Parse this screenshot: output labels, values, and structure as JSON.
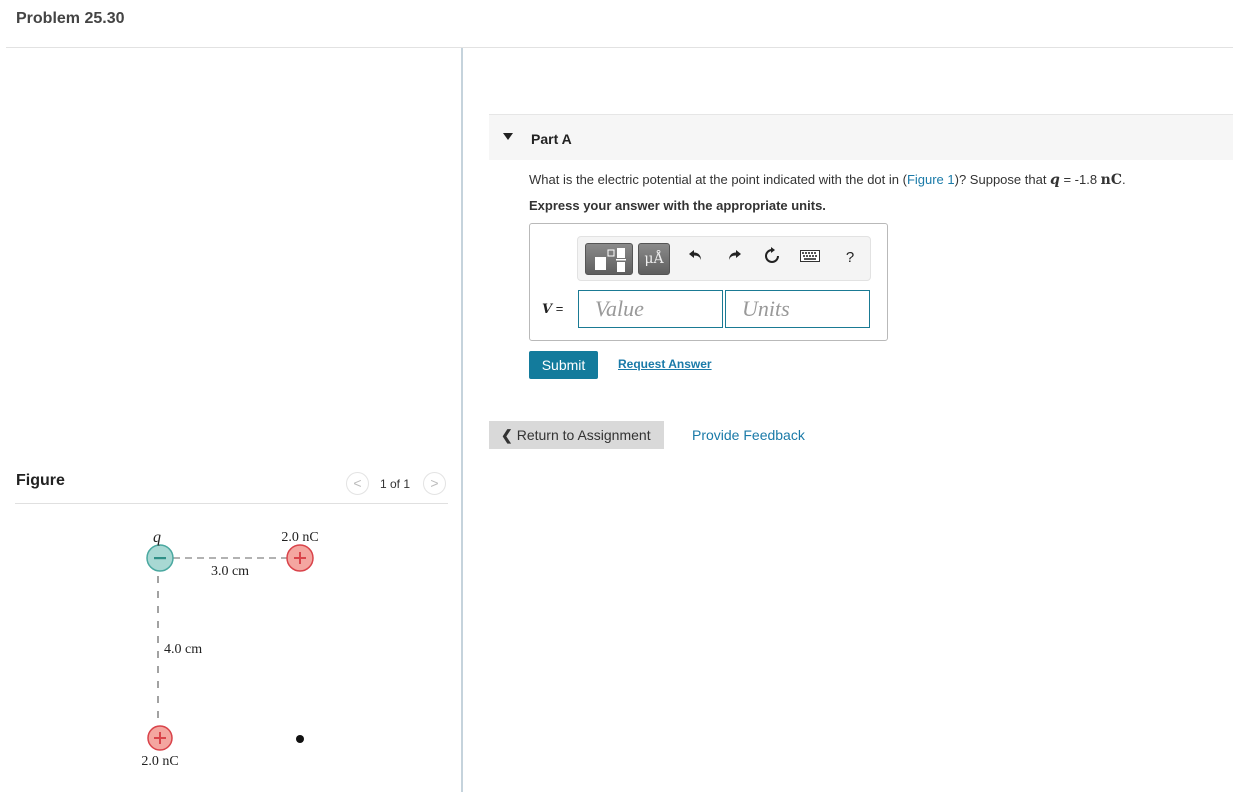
{
  "page": {
    "problem_title": "Problem 25.30"
  },
  "part": {
    "label": "Part A",
    "question_prefix": "What is the electric potential at the point indicated with the dot in (",
    "figure_link": "Figure 1",
    "question_middle": ")? Suppose that ",
    "q_symbol": "q",
    "q_equals": " = -1.8 ",
    "q_unit": "nC",
    "q_suffix": ".",
    "instruction": "Express your answer with the appropriate units."
  },
  "answer": {
    "variable": "V",
    "equals": " =",
    "value_placeholder": "Value",
    "units_placeholder": "Units",
    "value": "",
    "units_value": ""
  },
  "toolbar": {
    "templates_icon": "templates-icon",
    "units_label": "μÅ",
    "undo_icon": "undo-icon",
    "redo_icon": "redo-icon",
    "reset_icon": "reset-icon",
    "keyboard_icon": "keyboard-icon",
    "help_label": "?"
  },
  "actions": {
    "submit_label": "Submit",
    "request_answer_label": "Request Answer",
    "return_label": "Return to Assignment",
    "feedback_label": "Provide Feedback"
  },
  "figure": {
    "title": "Figure",
    "counter": "1 of 1",
    "prev_icon": "<",
    "next_icon": ">",
    "labels": {
      "q": "q",
      "top_right_charge": "2.0 nC",
      "horizontal_distance": "3.0 cm",
      "vertical_distance": "4.0 cm",
      "bottom_left_charge": "2.0 nC"
    },
    "charges": [
      {
        "name": "q",
        "sign": "−",
        "color": "#a8d8d3",
        "stroke": "#4aa8a0"
      },
      {
        "name": "top-right",
        "sign": "+",
        "color": "#f4a6a0",
        "stroke": "#d9434a"
      },
      {
        "name": "bottom-left",
        "sign": "+",
        "color": "#f4a6a0",
        "stroke": "#d9434a"
      }
    ]
  },
  "colors": {
    "accent": "#137b9c",
    "link": "#1a7aa8"
  }
}
